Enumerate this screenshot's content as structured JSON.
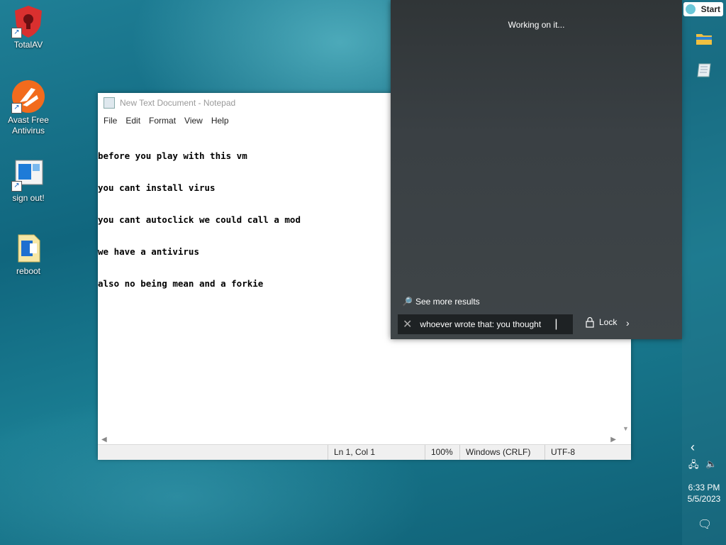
{
  "desktop": {
    "icons": [
      {
        "label": "TotalAV",
        "icon": "totalav-shield-icon"
      },
      {
        "label": "Avast Free Antivirus",
        "icon": "avast-icon"
      },
      {
        "label": "sign out!",
        "icon": "signout-shortcut-icon"
      },
      {
        "label": "reboot",
        "icon": "reboot-file-icon"
      }
    ]
  },
  "notepad": {
    "title": "New Text Document - Notepad",
    "menu": [
      "File",
      "Edit",
      "Format",
      "View",
      "Help"
    ],
    "lines": [
      "before you play with this vm",
      "you cant install virus",
      "you cant autoclick we could call a mod",
      "we have a antivirus",
      "also no being mean and a forkie"
    ],
    "status": {
      "position": "Ln 1, Col 1",
      "zoom": "100%",
      "line_ending": "Windows (CRLF)",
      "encoding": "UTF-8"
    }
  },
  "start_panel": {
    "working_text": "Working on it...",
    "see_more": "See more results",
    "search_value": "whoever wrote that: you thought",
    "lock_label": "Lock",
    "start_label": "Start"
  },
  "taskbar": {
    "time": "6:33 PM",
    "date": "5/5/2023",
    "colors": {
      "accent": "#f0c040",
      "panel": "#3a4044"
    }
  }
}
